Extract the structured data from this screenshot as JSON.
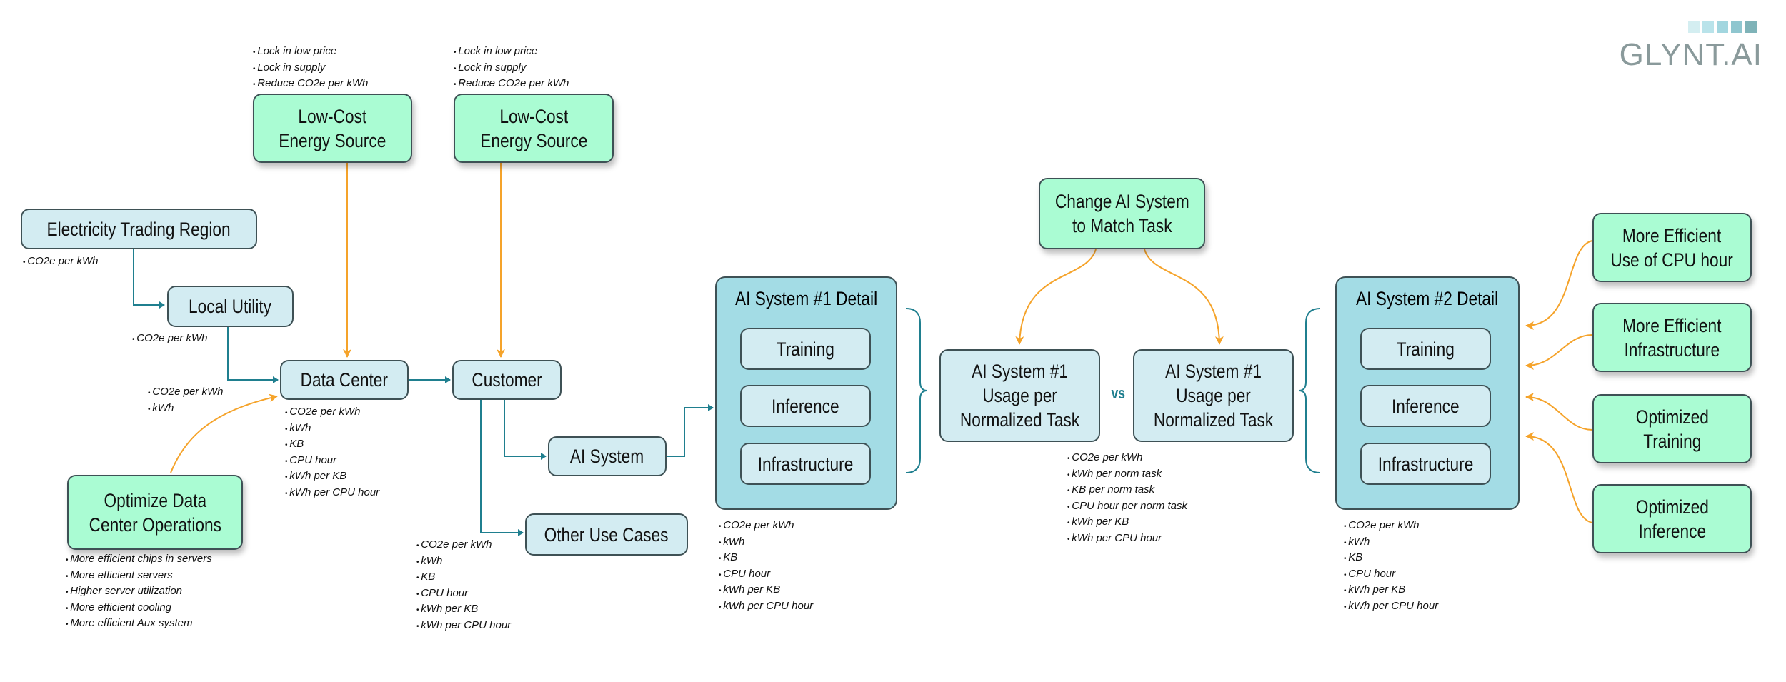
{
  "colors": {
    "teal_connector": "#1f7f8f",
    "orange_connector": "#f5a32a",
    "blue_box": "#d3ecf2",
    "green_box": "#aafcd3",
    "detail_panel": "#a3dce5",
    "logo_gray": "#8a9a9b"
  },
  "logo": {
    "text": "GLYNT.AI",
    "squares": [
      "#d4eef1",
      "#b9e3ea",
      "#a2d6df",
      "#8fc6cf",
      "#7fb3b8"
    ]
  },
  "nodes": {
    "electricity_trading_region": "Electricity Trading Region",
    "local_utility": "Local Utility",
    "low_cost_energy_1": "Low-Cost\nEnergy Source",
    "low_cost_energy_2": "Low-Cost\nEnergy Source",
    "data_center": "Data Center",
    "customer": "Customer",
    "ai_system": "AI System",
    "other_use_cases": "Other Use Cases",
    "optimize_dc_ops": "Optimize Data\nCenter Operations",
    "change_ai_system": "Change AI System\nto Match Task",
    "usage_left": "AI System #1\nUsage per\nNormalized Task",
    "usage_right": "AI System #1\nUsage per\nNormalized Task",
    "vs": "vs",
    "more_efficient_cpu": "More Efficient\nUse of CPU hour",
    "more_efficient_infra": "More Efficient\nInfrastructure",
    "optimized_training": "Optimized\nTraining",
    "optimized_inference": "Optimized\nInference"
  },
  "detail1": {
    "title": "AI System #1 Detail",
    "items": [
      "Training",
      "Inference",
      "Infrastructure"
    ]
  },
  "detail2": {
    "title": "AI System #2 Detail",
    "items": [
      "Training",
      "Inference",
      "Infrastructure"
    ]
  },
  "notes": {
    "low_cost_1": [
      "Lock in low price",
      "Lock in supply",
      "Reduce CO2e per kWh"
    ],
    "low_cost_2": [
      "Lock in low price",
      "Lock in supply",
      "Reduce CO2e per kWh"
    ],
    "electricity_trading_region": [
      "CO2e per kWh"
    ],
    "local_utility": [
      "CO2e per kWh"
    ],
    "data_center_input": [
      "CO2e per kWh",
      "kWh"
    ],
    "data_center": [
      "CO2e per kWh",
      "kWh",
      "KB",
      "CPU hour",
      "kWh per KB",
      "kWh per CPU hour"
    ],
    "optimize_dc_ops": [
      "More efficient chips in servers",
      "More efficient servers",
      "Higher server utilization",
      "More efficient cooling",
      "More efficient Aux system"
    ],
    "customer": [
      "CO2e per kWh",
      "kWh",
      "KB",
      "CPU hour",
      "kWh per KB",
      "kWh per CPU hour"
    ],
    "detail1": [
      "CO2e per kWh",
      "kWh",
      "KB",
      "CPU hour",
      "kWh per KB",
      "kWh per CPU hour"
    ],
    "usage": [
      "CO2e per kWh",
      "kWh per norm task",
      "KB per norm task",
      "CPU hour per norm task",
      "kWh per KB",
      "kWh per CPU hour"
    ],
    "detail2": [
      "CO2e per kWh",
      "kWh",
      "KB",
      "CPU hour",
      "kWh per KB",
      "kWh per CPU hour"
    ]
  }
}
